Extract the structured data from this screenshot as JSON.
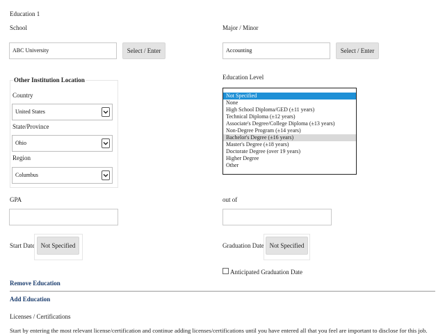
{
  "section": {
    "title": "Education 1"
  },
  "school": {
    "label": "School",
    "value": "ABC University",
    "button_label": "Select / Enter"
  },
  "major": {
    "label": "Major / Minor",
    "value": "Accounting",
    "button_label": "Select / Enter"
  },
  "location": {
    "heading": "Other Institution Location",
    "country_label": "Country",
    "country_value": "United States",
    "state_label": "State/Province",
    "state_value": "Ohio",
    "region_label": "Region",
    "region_value": "Columbus"
  },
  "education_level": {
    "label": "Education Level",
    "options": [
      "Not Specified",
      "None",
      "High School Diploma/GED (±11 years)",
      "Technical Diploma (±12 years)",
      "Associate's Degree/College Diploma (±13 years)",
      "Non-Degree Program (±14 years)",
      "Bachelor's Degree (±16 years)",
      "Master's Degree (±18 years)",
      "Doctorate Degree (over 19 years)",
      "Higher Degree",
      "Other"
    ],
    "selected": "Not Specified",
    "hovered": "Bachelor's Degree (±16 years)"
  },
  "gpa": {
    "label": "GPA",
    "value": ""
  },
  "out_of": {
    "label": "out of",
    "value": ""
  },
  "start_date": {
    "label": "Start Date",
    "button_label": "Not Specified"
  },
  "graduation_date": {
    "label": "Graduation Date",
    "button_label": "Not Specified"
  },
  "anticipated": {
    "label": "Anticipated Graduation Date",
    "checked": false
  },
  "links": {
    "remove_education": "Remove Education",
    "add_education": "Add Education"
  },
  "licenses": {
    "title": "Licenses / Certifications",
    "instructions": "Start by entering the most relevant license/certification and continue adding licenses/certifications until you have entered all that you feel are important to disclose for this job."
  }
}
